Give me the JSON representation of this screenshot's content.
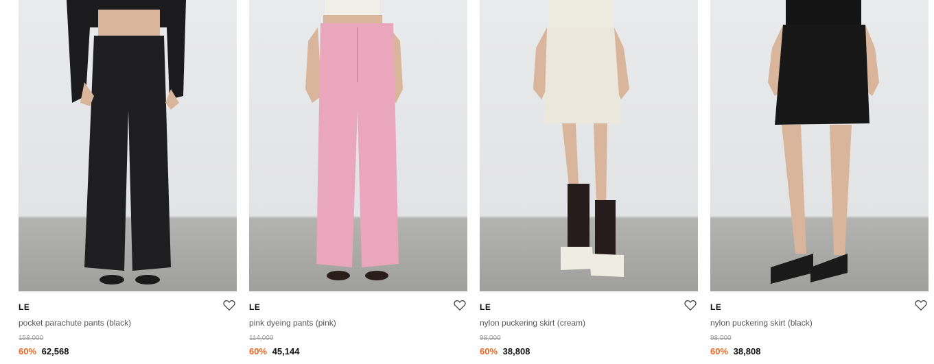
{
  "products": [
    {
      "brand": "LE",
      "name": "pocket parachute pants (black)",
      "original_price": "158,000",
      "discount": "60%",
      "sale_price": "62,568",
      "wishlist_icon": "heart-outline-icon",
      "photo_colors": {
        "top": "#1b1b1d",
        "bottom": "#1e1e20",
        "skin": "#d9b59c",
        "shoe": "#1a1a1a"
      }
    },
    {
      "brand": "LE",
      "name": "pink dyeing pants (pink)",
      "original_price": "114,000",
      "discount": "60%",
      "sale_price": "45,144",
      "wishlist_icon": "heart-outline-icon",
      "photo_colors": {
        "top": "#f1efe8",
        "bottom": "#e9a6bd",
        "skin": "#d9b59c",
        "shoe": "#2a1e1b"
      }
    },
    {
      "brand": "LE",
      "name": "nylon puckering skirt (cream)",
      "original_price": "98,000",
      "discount": "60%",
      "sale_price": "38,808",
      "wishlist_icon": "heart-outline-icon",
      "photo_colors": {
        "top": "#eeebe0",
        "bottom": "#ece7dc",
        "skin": "#d9b59c",
        "shoe": "#efece4",
        "sock": "#261c1c"
      }
    },
    {
      "brand": "LE",
      "name": "nylon puckering skirt (black)",
      "original_price": "98,000",
      "discount": "60%",
      "sale_price": "38,808",
      "wishlist_icon": "heart-outline-icon",
      "photo_colors": {
        "top": "#141414",
        "bottom": "#171717",
        "skin": "#d9b59c",
        "shoe": "#1a1a1a"
      }
    }
  ],
  "colors": {
    "discount": "#f26722",
    "original_price": "#9a9a9a",
    "brand": "#111111"
  }
}
